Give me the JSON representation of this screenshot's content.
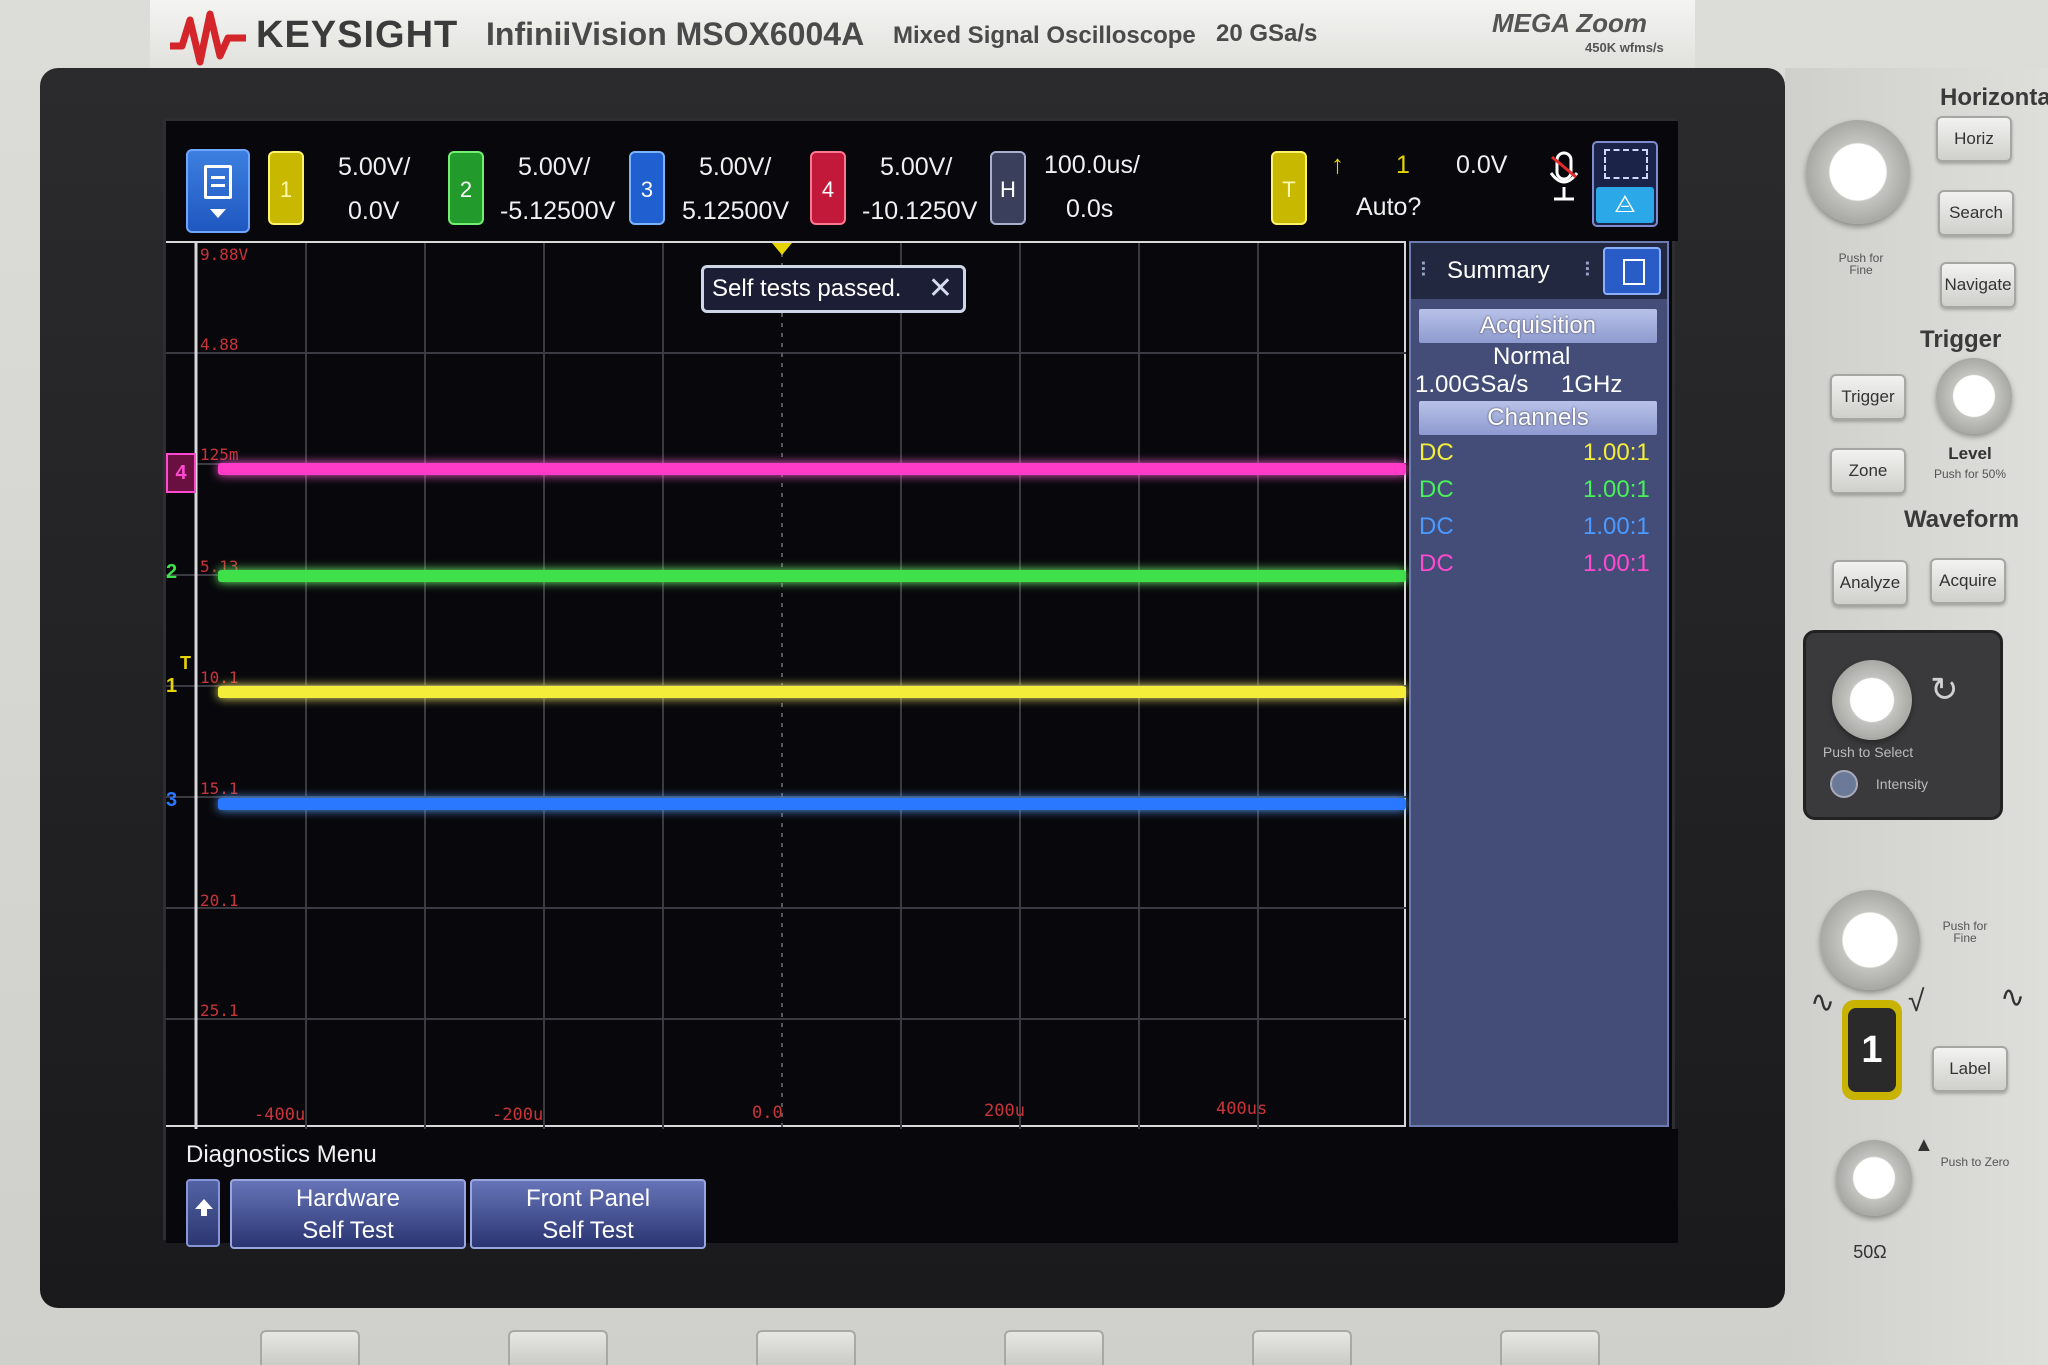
{
  "brand": {
    "name": "KEYSIGHT",
    "model": "InfiniiVision MSOX6004A",
    "description": "Mixed Signal Oscilloscope",
    "sample_rate": "20 GSa/s",
    "megazoom": "MEGA Zoom",
    "megazoom_sub": "450K wfms/s",
    "accent_color": "#d4252a"
  },
  "channels": [
    {
      "number": "1",
      "scale": "5.00V/",
      "offset": "0.0V",
      "color": "#e6d400"
    },
    {
      "number": "2",
      "scale": "5.00V/",
      "offset": "-5.12500V",
      "color": "#2fc23a"
    },
    {
      "number": "3",
      "scale": "5.00V/",
      "offset": "5.12500V",
      "color": "#2f7ff0"
    },
    {
      "number": "4",
      "scale": "5.00V/",
      "offset": "-10.1250V",
      "color": "#e42a4a"
    }
  ],
  "horizontal": {
    "label": "H",
    "scale": "100.0us/",
    "position": "0.0s"
  },
  "trigger": {
    "label": "T",
    "source": "1",
    "level": "0.0V",
    "mode": "Auto?"
  },
  "toast": {
    "message": "Self tests passed."
  },
  "grid": {
    "y_labels": [
      "9.88V",
      "4.88",
      "125m",
      "5.13",
      "10.1",
      "15.1",
      "20.1",
      "25.1"
    ],
    "x_labels": [
      "-400u",
      "-200u",
      "0.0",
      "200u",
      "400us"
    ]
  },
  "markers": {
    "ch4": "4",
    "ch2": "2",
    "ch1": "1",
    "ch3": "3",
    "trigger": "T"
  },
  "summary": {
    "title": "Summary",
    "acquisition_header": "Acquisition",
    "acquisition_mode": "Normal",
    "acquisition_rate": "1.00GSa/s",
    "bandwidth": "1GHz",
    "channels_header": "Channels",
    "channel_rows": [
      {
        "coupling": "DC",
        "probe": "1.00:1"
      },
      {
        "coupling": "DC",
        "probe": "1.00:1"
      },
      {
        "coupling": "DC",
        "probe": "1.00:1"
      },
      {
        "coupling": "DC",
        "probe": "1.00:1"
      }
    ]
  },
  "softkeys": {
    "menu_title": "Diagnostics Menu",
    "hardware_line1": "Hardware",
    "hardware_line2": "Self Test",
    "frontpanel_line1": "Front Panel",
    "frontpanel_line2": "Self Test"
  },
  "panel": {
    "horizontal_title": "Horizontal",
    "horiz_btn": "Horiz",
    "search_btn": "Search",
    "navigate_btn": "Navigate",
    "push_fine": "Push for Fine",
    "trigger_title": "Trigger",
    "trigger_btn": "Trigger",
    "zone_btn": "Zone",
    "level_label": "Level",
    "level_sub": "Push for 50%",
    "waveform_title": "Waveform",
    "analyze_btn": "Analyze",
    "acquire_btn": "Acquire",
    "push_select": "Push to Select",
    "intensity": "Intensity",
    "push_fine2": "Push for Fine",
    "ch1_btn": "1",
    "label_btn": "Label",
    "push_zero": "Push to Zero",
    "impedance": "50Ω"
  }
}
